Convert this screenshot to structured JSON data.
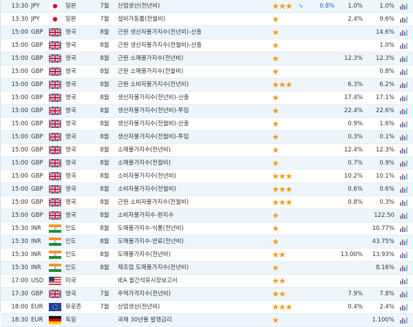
{
  "rows": [
    {
      "time": "13:30",
      "currency": "JPY",
      "flag": "jp",
      "country": "일본",
      "month": "7월",
      "event": "산업생산(전년비)",
      "importance": 3,
      "arrow": "arrow-down-right-icon",
      "actual": "0.8%",
      "forecast": "1.0%",
      "previous": "1.0%"
    },
    {
      "time": "13:30",
      "currency": "JPY",
      "flag": "jp",
      "country": "일본",
      "month": "7월",
      "event": "설비가동률(전월비)",
      "importance": 1,
      "arrow": "",
      "actual": "",
      "forecast": "2.4%",
      "previous": "9.6%"
    },
    {
      "time": "15:00",
      "currency": "GBP",
      "flag": "gb",
      "country": "영국",
      "month": "8월",
      "event": "근원 생산자물가지수(전년비)-산출",
      "importance": 1,
      "arrow": "",
      "actual": "",
      "forecast": "",
      "previous": "14.6%"
    },
    {
      "time": "15:00",
      "currency": "GBP",
      "flag": "gb",
      "country": "영국",
      "month": "8월",
      "event": "근원 생산자물가지수(전월비)-산출",
      "importance": 1,
      "arrow": "",
      "actual": "",
      "forecast": "",
      "previous": "1.0%"
    },
    {
      "time": "15:00",
      "currency": "GBP",
      "flag": "gb",
      "country": "영국",
      "month": "8월",
      "event": "근원 소매물가지수(전년비)",
      "importance": 1,
      "arrow": "",
      "actual": "",
      "forecast": "12.3%",
      "previous": "12.3%"
    },
    {
      "time": "15:00",
      "currency": "GBP",
      "flag": "gb",
      "country": "영국",
      "month": "8월",
      "event": "근원 소매물가지수(전월비)",
      "importance": 1,
      "arrow": "",
      "actual": "",
      "forecast": "",
      "previous": "0.8%"
    },
    {
      "time": "15:00",
      "currency": "GBP",
      "flag": "gb",
      "country": "영국",
      "month": "8월",
      "event": "근원 소비자물가지수(전년비)",
      "importance": 3,
      "arrow": "",
      "actual": "",
      "forecast": "6.3%",
      "previous": "6.2%"
    },
    {
      "time": "15:00",
      "currency": "GBP",
      "flag": "gb",
      "country": "영국",
      "month": "8월",
      "event": "생산자물가지수(전년비)-산출",
      "importance": 1,
      "arrow": "",
      "actual": "",
      "forecast": "17.4%",
      "previous": "17.1%"
    },
    {
      "time": "15:00",
      "currency": "GBP",
      "flag": "gb",
      "country": "영국",
      "month": "8월",
      "event": "생산자물가지수(전년비)-투입",
      "importance": 1,
      "arrow": "",
      "actual": "",
      "forecast": "22.4%",
      "previous": "22.6%"
    },
    {
      "time": "15:00",
      "currency": "GBP",
      "flag": "gb",
      "country": "영국",
      "month": "8월",
      "event": "생산자물가지수(전월비)-산출",
      "importance": 1,
      "arrow": "",
      "actual": "",
      "forecast": "0.9%",
      "previous": "1.6%"
    },
    {
      "time": "15:00",
      "currency": "GBP",
      "flag": "gb",
      "country": "영국",
      "month": "8월",
      "event": "생산자물가지수(전월비)-투입",
      "importance": 1,
      "arrow": "",
      "actual": "",
      "forecast": "0.3%",
      "previous": "0.1%"
    },
    {
      "time": "15:00",
      "currency": "GBP",
      "flag": "gb",
      "country": "영국",
      "month": "8월",
      "event": "소매물가지수(전년비)",
      "importance": 1,
      "arrow": "",
      "actual": "",
      "forecast": "12.4%",
      "previous": "12.3%"
    },
    {
      "time": "15:00",
      "currency": "GBP",
      "flag": "gb",
      "country": "영국",
      "month": "8월",
      "event": "소매물가지수(전월비)",
      "importance": 1,
      "arrow": "",
      "actual": "",
      "forecast": "0.7%",
      "previous": "0.9%"
    },
    {
      "time": "15:00",
      "currency": "GBP",
      "flag": "gb",
      "country": "영국",
      "month": "8월",
      "event": "소비자물가지수(전년비)",
      "importance": 3,
      "arrow": "",
      "actual": "",
      "forecast": "10.2%",
      "previous": "10.1%"
    },
    {
      "time": "15:00",
      "currency": "GBP",
      "flag": "gb",
      "country": "영국",
      "month": "8월",
      "event": "소비자물가지수(전월비)",
      "importance": 3,
      "arrow": "",
      "actual": "",
      "forecast": "0.6%",
      "previous": "0.6%"
    },
    {
      "time": "15:00",
      "currency": "GBP",
      "flag": "gb",
      "country": "영국",
      "month": "8월",
      "event": "근원 소비자물가지수(전월비)",
      "importance": 3,
      "arrow": "",
      "actual": "",
      "forecast": "0.8%",
      "previous": "0.3%"
    },
    {
      "time": "15:00",
      "currency": "GBP",
      "flag": "gb",
      "country": "영국",
      "month": "8월",
      "event": "소비자물가지수-원지수",
      "importance": 1,
      "arrow": "",
      "actual": "",
      "forecast": "",
      "previous": "122.50"
    },
    {
      "time": "15:30",
      "currency": "INR",
      "flag": "in",
      "country": "인도",
      "month": "8월",
      "event": "도매물가지수-식품(전년비)",
      "importance": 1,
      "arrow": "",
      "actual": "",
      "forecast": "",
      "previous": "10.77%"
    },
    {
      "time": "15:30",
      "currency": "INR",
      "flag": "in",
      "country": "인도",
      "month": "8월",
      "event": "도매물가지수-연료(전년비)",
      "importance": 1,
      "arrow": "",
      "actual": "",
      "forecast": "",
      "previous": "43.75%"
    },
    {
      "time": "15:30",
      "currency": "INR",
      "flag": "in",
      "country": "인도",
      "month": "8월",
      "event": "도매물가지수(전년비)",
      "importance": 2,
      "arrow": "",
      "actual": "",
      "forecast": "13.00%",
      "previous": "13.93%"
    },
    {
      "time": "15:30",
      "currency": "INR",
      "flag": "in",
      "country": "인도",
      "month": "8월",
      "event": "제조업 도매물가지수(전년비)",
      "importance": 1,
      "arrow": "",
      "actual": "",
      "forecast": "",
      "previous": "8.16%"
    },
    {
      "time": "17:00",
      "currency": "USD",
      "flag": "us",
      "country": "미국",
      "month": "",
      "event": "IEA 월간석유시장보고서",
      "importance": 2,
      "arrow": "",
      "actual": "",
      "forecast": "",
      "previous": ""
    },
    {
      "time": "17:30",
      "currency": "GBP",
      "flag": "gb",
      "country": "영국",
      "month": "7월",
      "event": "주택가격지수(전년비)",
      "importance": 2,
      "arrow": "",
      "actual": "",
      "forecast": "7.9%",
      "previous": "7.8%"
    },
    {
      "time": "18:00",
      "currency": "EUR",
      "flag": "eu",
      "country": "유로존",
      "month": "7월",
      "event": "산업생산(전년비)",
      "importance": 3,
      "arrow": "",
      "actual": "",
      "forecast": "0.4%",
      "previous": "2.4%"
    },
    {
      "time": "18:30",
      "currency": "EUR",
      "flag": "de",
      "country": "독일",
      "month": "",
      "event": "국채 30년물 발행금리",
      "importance": 1,
      "arrow": "",
      "actual": "",
      "forecast": "",
      "previous": "1.100%"
    }
  ],
  "flags": {
    "jp": "japan-flag-icon",
    "gb": "uk-flag-icon",
    "in": "india-flag-icon",
    "us": "usa-flag-icon",
    "eu": "eu-flag-icon",
    "de": "germany-flag-icon"
  },
  "colors": {
    "star": "#f29a17",
    "actual": "#2060c0",
    "alt_row": "#eef6fb",
    "row_border": "#e3edf3"
  }
}
